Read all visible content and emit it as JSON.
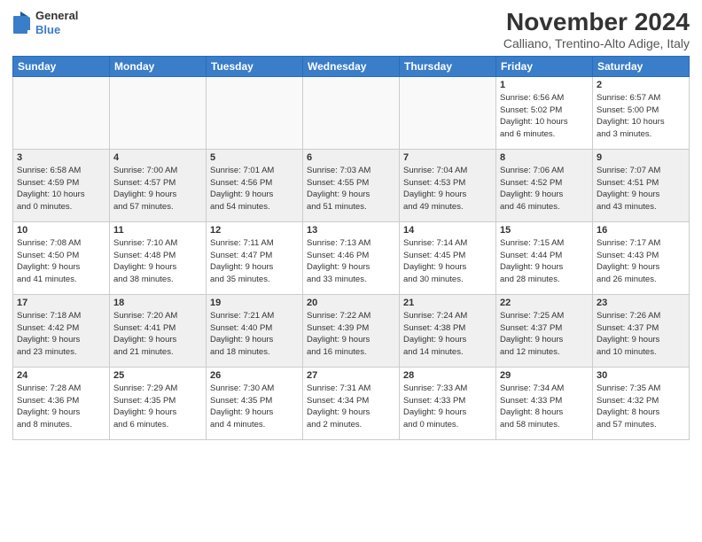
{
  "logo": {
    "general": "General",
    "blue": "Blue"
  },
  "header": {
    "month": "November 2024",
    "location": "Calliano, Trentino-Alto Adige, Italy"
  },
  "weekdays": [
    "Sunday",
    "Monday",
    "Tuesday",
    "Wednesday",
    "Thursday",
    "Friday",
    "Saturday"
  ],
  "weeks": [
    [
      {
        "day": "",
        "info": ""
      },
      {
        "day": "",
        "info": ""
      },
      {
        "day": "",
        "info": ""
      },
      {
        "day": "",
        "info": ""
      },
      {
        "day": "",
        "info": ""
      },
      {
        "day": "1",
        "info": "Sunrise: 6:56 AM\nSunset: 5:02 PM\nDaylight: 10 hours\nand 6 minutes."
      },
      {
        "day": "2",
        "info": "Sunrise: 6:57 AM\nSunset: 5:00 PM\nDaylight: 10 hours\nand 3 minutes."
      }
    ],
    [
      {
        "day": "3",
        "info": "Sunrise: 6:58 AM\nSunset: 4:59 PM\nDaylight: 10 hours\nand 0 minutes."
      },
      {
        "day": "4",
        "info": "Sunrise: 7:00 AM\nSunset: 4:57 PM\nDaylight: 9 hours\nand 57 minutes."
      },
      {
        "day": "5",
        "info": "Sunrise: 7:01 AM\nSunset: 4:56 PM\nDaylight: 9 hours\nand 54 minutes."
      },
      {
        "day": "6",
        "info": "Sunrise: 7:03 AM\nSunset: 4:55 PM\nDaylight: 9 hours\nand 51 minutes."
      },
      {
        "day": "7",
        "info": "Sunrise: 7:04 AM\nSunset: 4:53 PM\nDaylight: 9 hours\nand 49 minutes."
      },
      {
        "day": "8",
        "info": "Sunrise: 7:06 AM\nSunset: 4:52 PM\nDaylight: 9 hours\nand 46 minutes."
      },
      {
        "day": "9",
        "info": "Sunrise: 7:07 AM\nSunset: 4:51 PM\nDaylight: 9 hours\nand 43 minutes."
      }
    ],
    [
      {
        "day": "10",
        "info": "Sunrise: 7:08 AM\nSunset: 4:50 PM\nDaylight: 9 hours\nand 41 minutes."
      },
      {
        "day": "11",
        "info": "Sunrise: 7:10 AM\nSunset: 4:48 PM\nDaylight: 9 hours\nand 38 minutes."
      },
      {
        "day": "12",
        "info": "Sunrise: 7:11 AM\nSunset: 4:47 PM\nDaylight: 9 hours\nand 35 minutes."
      },
      {
        "day": "13",
        "info": "Sunrise: 7:13 AM\nSunset: 4:46 PM\nDaylight: 9 hours\nand 33 minutes."
      },
      {
        "day": "14",
        "info": "Sunrise: 7:14 AM\nSunset: 4:45 PM\nDaylight: 9 hours\nand 30 minutes."
      },
      {
        "day": "15",
        "info": "Sunrise: 7:15 AM\nSunset: 4:44 PM\nDaylight: 9 hours\nand 28 minutes."
      },
      {
        "day": "16",
        "info": "Sunrise: 7:17 AM\nSunset: 4:43 PM\nDaylight: 9 hours\nand 26 minutes."
      }
    ],
    [
      {
        "day": "17",
        "info": "Sunrise: 7:18 AM\nSunset: 4:42 PM\nDaylight: 9 hours\nand 23 minutes."
      },
      {
        "day": "18",
        "info": "Sunrise: 7:20 AM\nSunset: 4:41 PM\nDaylight: 9 hours\nand 21 minutes."
      },
      {
        "day": "19",
        "info": "Sunrise: 7:21 AM\nSunset: 4:40 PM\nDaylight: 9 hours\nand 18 minutes."
      },
      {
        "day": "20",
        "info": "Sunrise: 7:22 AM\nSunset: 4:39 PM\nDaylight: 9 hours\nand 16 minutes."
      },
      {
        "day": "21",
        "info": "Sunrise: 7:24 AM\nSunset: 4:38 PM\nDaylight: 9 hours\nand 14 minutes."
      },
      {
        "day": "22",
        "info": "Sunrise: 7:25 AM\nSunset: 4:37 PM\nDaylight: 9 hours\nand 12 minutes."
      },
      {
        "day": "23",
        "info": "Sunrise: 7:26 AM\nSunset: 4:37 PM\nDaylight: 9 hours\nand 10 minutes."
      }
    ],
    [
      {
        "day": "24",
        "info": "Sunrise: 7:28 AM\nSunset: 4:36 PM\nDaylight: 9 hours\nand 8 minutes."
      },
      {
        "day": "25",
        "info": "Sunrise: 7:29 AM\nSunset: 4:35 PM\nDaylight: 9 hours\nand 6 minutes."
      },
      {
        "day": "26",
        "info": "Sunrise: 7:30 AM\nSunset: 4:35 PM\nDaylight: 9 hours\nand 4 minutes."
      },
      {
        "day": "27",
        "info": "Sunrise: 7:31 AM\nSunset: 4:34 PM\nDaylight: 9 hours\nand 2 minutes."
      },
      {
        "day": "28",
        "info": "Sunrise: 7:33 AM\nSunset: 4:33 PM\nDaylight: 9 hours\nand 0 minutes."
      },
      {
        "day": "29",
        "info": "Sunrise: 7:34 AM\nSunset: 4:33 PM\nDaylight: 8 hours\nand 58 minutes."
      },
      {
        "day": "30",
        "info": "Sunrise: 7:35 AM\nSunset: 4:32 PM\nDaylight: 8 hours\nand 57 minutes."
      }
    ]
  ]
}
